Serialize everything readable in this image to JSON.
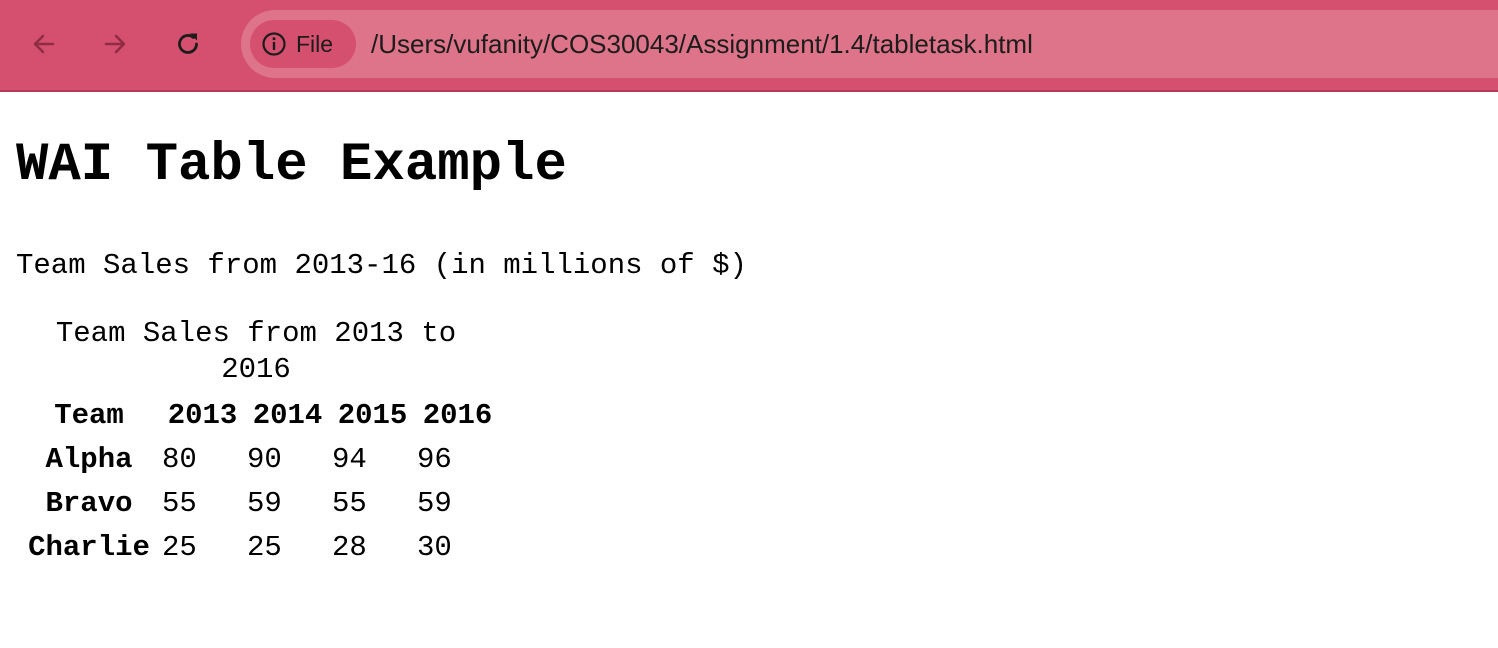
{
  "browser": {
    "nav_icons": [
      "back-arrow-icon",
      "forward-arrow-icon",
      "reload-icon"
    ],
    "chip_icon": "info-icon",
    "chip_label": "File",
    "url": "/Users/vufanity/COS30043/Assignment/1.4/tabletask.html",
    "colors": {
      "toolbar": "#d5506f",
      "omnibox": "#de7489"
    }
  },
  "page": {
    "title": "WAI Table Example",
    "intro": "Team Sales from 2013-16 (in millions of $)",
    "table": {
      "caption": "Team Sales from 2013 to 2016",
      "headers": [
        "Team",
        "2013",
        "2014",
        "2015",
        "2016"
      ],
      "rows": [
        {
          "team": "Alpha",
          "values": [
            "80",
            "90",
            "94",
            "96"
          ]
        },
        {
          "team": "Bravo",
          "values": [
            "55",
            "59",
            "55",
            "59"
          ]
        },
        {
          "team": "Charlie",
          "values": [
            "25",
            "25",
            "28",
            "30"
          ]
        }
      ]
    }
  }
}
